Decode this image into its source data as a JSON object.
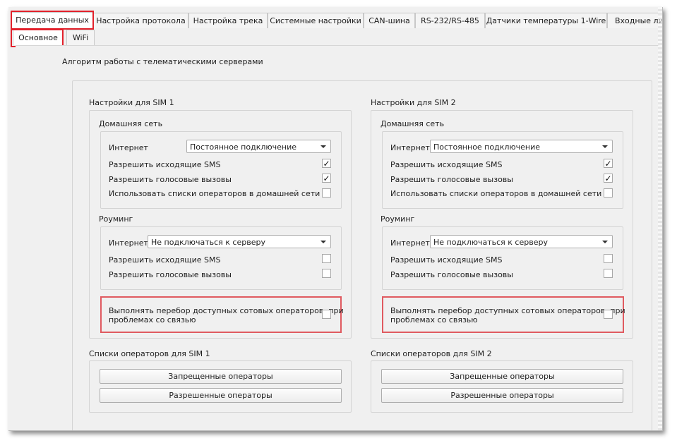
{
  "tabs": [
    {
      "label": "Передача данных",
      "active": true
    },
    {
      "label": "Настройка протокола"
    },
    {
      "label": "Настройка трека"
    },
    {
      "label": "Системные настройки"
    },
    {
      "label": "CAN-шина"
    },
    {
      "label": "RS-232/RS-485"
    },
    {
      "label": "Датчики температуры 1-Wire"
    },
    {
      "label": "Входные линии"
    }
  ],
  "subtabs": [
    {
      "label": "Основное",
      "active": true
    },
    {
      "label": "WiFi"
    }
  ],
  "group_title": "Алгоритм работы с телематическими серверами",
  "sim1": {
    "title": "Настройки для SIM 1",
    "home": {
      "title": "Домашняя сеть",
      "internet_label": "Интернет",
      "internet_value": "Постоянное подключение",
      "sms_label": "Разрешить исходящие SMS",
      "sms_checked": true,
      "calls_label": "Разрешить голосовые вызовы",
      "calls_checked": true,
      "operators_label": "Использовать списки операторов в домашней сети",
      "operators_checked": false
    },
    "roaming": {
      "title": "Роуминг",
      "internet_label": "Интернет",
      "internet_value": "Не подключаться к серверу",
      "sms_label": "Разрешить исходящие SMS",
      "sms_checked": false,
      "calls_label": "Разрешить голосовые вызовы",
      "calls_checked": false
    },
    "search_line1": "Выполнять перебор доступных сотовых операторов, при",
    "search_line2": "проблемах со связью",
    "search_checked": false,
    "lists_title": "Списки операторов для SIM 1",
    "forbidden_button": "Запрещенные операторы",
    "allowed_button": "Разрешенные операторы"
  },
  "sim2": {
    "title": "Настройки для SIM 2",
    "home": {
      "title": "Домашняя сеть",
      "internet_label": "Интернет",
      "internet_value": "Постоянное подключение",
      "sms_label": "Разрешить исходящие SMS",
      "sms_checked": true,
      "calls_label": "Разрешить голосовые вызовы",
      "calls_checked": true,
      "operators_label": "Использовать списки операторов в домашней сети",
      "operators_checked": false
    },
    "roaming": {
      "title": "Роуминг",
      "internet_label": "Интернет",
      "internet_value": "Не подключаться к серверу",
      "sms_label": "Разрешить исходящие SMS",
      "sms_checked": false,
      "calls_label": "Разрешить голосовые вызовы",
      "calls_checked": false
    },
    "search_line1": "Выполнять перебор доступных сотовых операторов, при",
    "search_line2": "проблемах со связью",
    "search_checked": false,
    "lists_title": "Списки операторов для SIM 2",
    "forbidden_button": "Запрещенные операторы",
    "allowed_button": "Разрешенные операторы"
  },
  "colors": {
    "highlight_red": "#e2212b",
    "panel_bg": "#f0f0f0"
  }
}
